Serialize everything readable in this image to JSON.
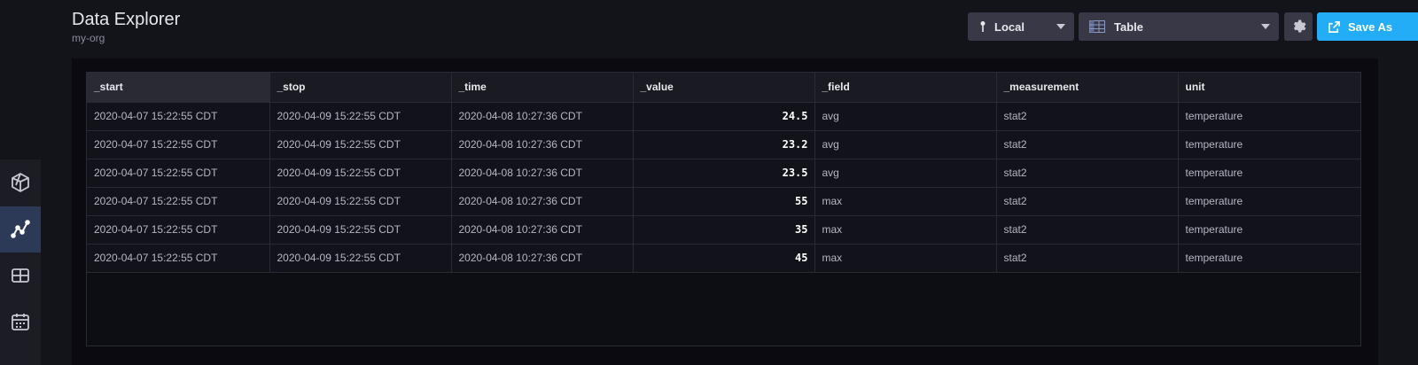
{
  "header": {
    "title": "Data Explorer",
    "org": "my-org"
  },
  "toolbar": {
    "time_zone": "Local",
    "view_type": "Table",
    "settings_icon": "gear-icon",
    "save_label": "Save As",
    "save_color": "#22adf6"
  },
  "nav": {
    "items": [
      {
        "icon": "polyhedron-icon",
        "active": false
      },
      {
        "icon": "data-explorer-icon",
        "active": true
      },
      {
        "icon": "dashboards-icon",
        "active": false
      },
      {
        "icon": "calendar-icon",
        "active": false
      }
    ]
  },
  "table": {
    "columns": [
      "_start",
      "_stop",
      "_time",
      "_value",
      "_field",
      "_measurement",
      "unit"
    ],
    "rows": [
      [
        "2020-04-07 15:22:55 CDT",
        "2020-04-09 15:22:55 CDT",
        "2020-04-08 10:27:36 CDT",
        "24.5",
        "avg",
        "stat2",
        "temperature"
      ],
      [
        "2020-04-07 15:22:55 CDT",
        "2020-04-09 15:22:55 CDT",
        "2020-04-08 10:27:36 CDT",
        "23.2",
        "avg",
        "stat2",
        "temperature"
      ],
      [
        "2020-04-07 15:22:55 CDT",
        "2020-04-09 15:22:55 CDT",
        "2020-04-08 10:27:36 CDT",
        "23.5",
        "avg",
        "stat2",
        "temperature"
      ],
      [
        "2020-04-07 15:22:55 CDT",
        "2020-04-09 15:22:55 CDT",
        "2020-04-08 10:27:36 CDT",
        "55",
        "max",
        "stat2",
        "temperature"
      ],
      [
        "2020-04-07 15:22:55 CDT",
        "2020-04-09 15:22:55 CDT",
        "2020-04-08 10:27:36 CDT",
        "35",
        "max",
        "stat2",
        "temperature"
      ],
      [
        "2020-04-07 15:22:55 CDT",
        "2020-04-09 15:22:55 CDT",
        "2020-04-08 10:27:36 CDT",
        "45",
        "max",
        "stat2",
        "temperature"
      ]
    ]
  }
}
